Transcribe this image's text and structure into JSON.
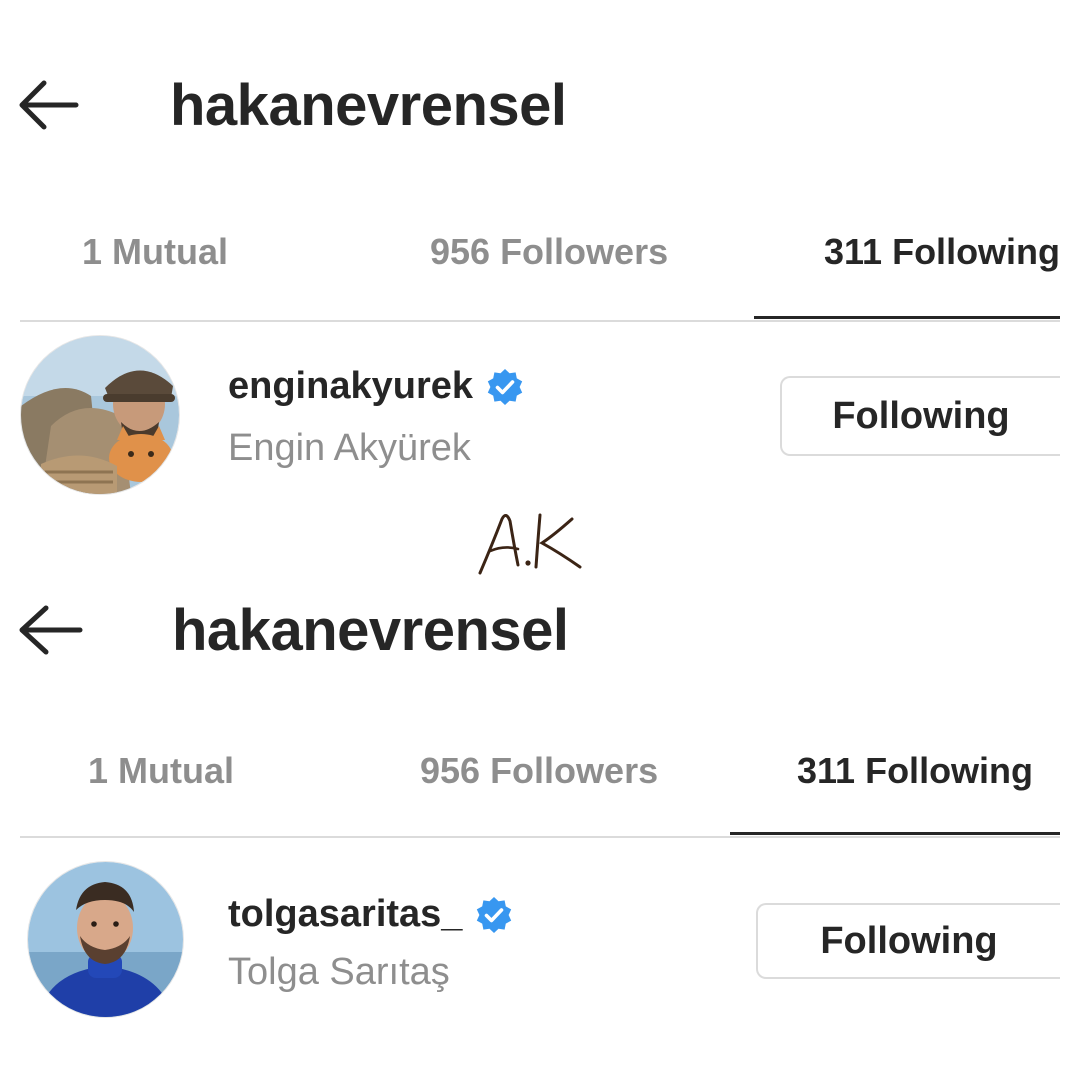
{
  "panels": [
    {
      "header": {
        "title": "hakanevrensel"
      },
      "tabs": [
        {
          "label": "1 Mutual",
          "active": false
        },
        {
          "label": "956 Followers",
          "active": false
        },
        {
          "label": "311 Following",
          "active": true
        }
      ],
      "user": {
        "username": "enginakyurek",
        "full_name": "Engin Akyürek",
        "verified": true,
        "button_label": "Following"
      }
    },
    {
      "header": {
        "title": "hakanevrensel"
      },
      "tabs": [
        {
          "label": "1 Mutual",
          "active": false
        },
        {
          "label": "956 Followers",
          "active": false
        },
        {
          "label": "311 Following",
          "active": true
        }
      ],
      "user": {
        "username": "tolgasaritas_",
        "full_name": "Tolga Sarıtaş",
        "verified": true,
        "button_label": "Following"
      }
    }
  ],
  "colors": {
    "verified": "#3897f0",
    "text_primary": "#262626",
    "text_secondary": "#8e8e8e",
    "divider": "#dbdbdb",
    "signature": "#3b2415"
  },
  "icons": {
    "back": "arrow-left-icon",
    "verified": "verified-badge-icon"
  }
}
